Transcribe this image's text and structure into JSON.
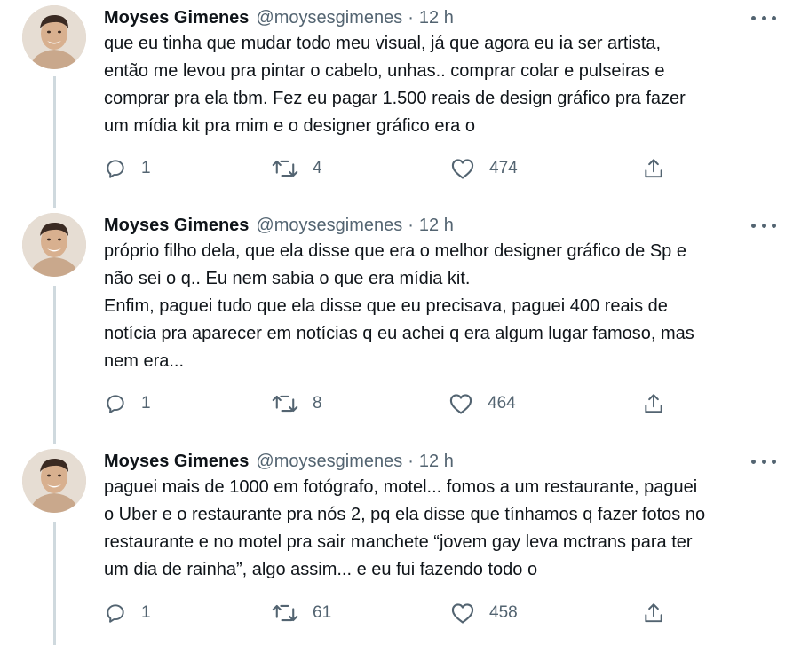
{
  "tweets": [
    {
      "author": "Moyses Gimenes",
      "handle": "@moysesgimenes",
      "separator": "·",
      "time": "12 h",
      "text": "que eu tinha que mudar todo meu visual, já que agora eu ia ser artista,\nentão me levou pra pintar o cabelo, unhas.. comprar colar e pulseiras e\ncomprar pra ela tbm. Fez eu pagar 1.500 reais de design gráfico pra fazer\num mídia kit pra mim e o designer gráfico era o",
      "replies": "1",
      "retweets": "4",
      "likes": "474"
    },
    {
      "author": "Moyses Gimenes",
      "handle": "@moysesgimenes",
      "separator": "·",
      "time": "12 h",
      "text": "próprio filho dela, que ela disse que era o melhor designer gráfico de Sp e\nnão sei o q.. Eu nem sabia o que era mídia kit.\nEnfim, paguei tudo que ela disse que eu precisava, paguei 400 reais de\nnotícia pra aparecer em notícias q eu achei q era algum lugar famoso, mas\nnem era...",
      "replies": "1",
      "retweets": "8",
      "likes": "464"
    },
    {
      "author": "Moyses Gimenes",
      "handle": "@moysesgimenes",
      "separator": "·",
      "time": "12 h",
      "text": "paguei mais de 1000 em fotógrafo, motel... fomos a um restaurante, paguei\no Uber e o restaurante pra nós 2, pq ela disse que tínhamos q fazer fotos no\nrestaurante e no motel pra sair manchete “jovem gay leva mctrans para ter\num dia de rainha”, algo assim... e eu fui fazendo todo o",
      "replies": "1",
      "retweets": "61",
      "likes": "458"
    }
  ],
  "icons": {
    "reply": "reply-icon",
    "retweet": "retweet-icon",
    "like": "like-icon",
    "share": "share-icon",
    "more": "more-icon"
  },
  "colors": {
    "text": "#0f1419",
    "secondary": "#536471",
    "thread_line": "#cfd9de",
    "background": "#ffffff"
  }
}
